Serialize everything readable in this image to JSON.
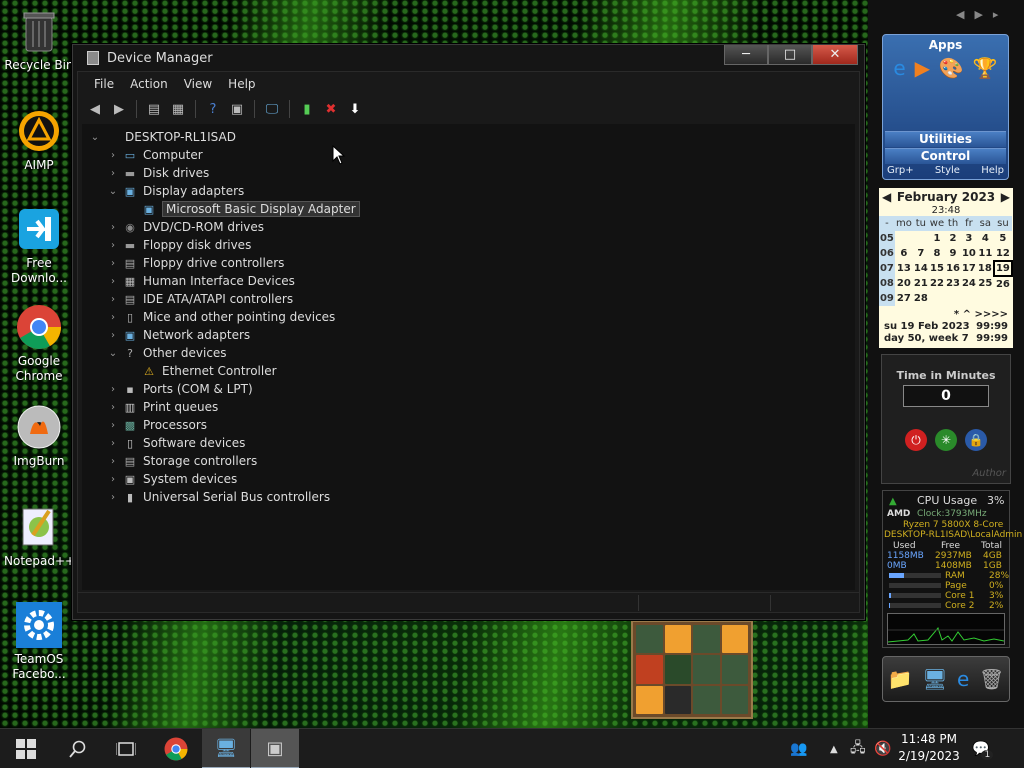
{
  "desktop": {
    "icons": [
      {
        "label": "Recycle Bin"
      },
      {
        "label": "AIMP"
      },
      {
        "label": "Free Downlo..."
      },
      {
        "label": "Google Chrome"
      },
      {
        "label": "ImgBurn"
      },
      {
        "label": "Notepad++"
      },
      {
        "label": "TeamOS Facebo..."
      }
    ]
  },
  "window": {
    "title": "Device Manager",
    "buttons": {
      "minimize": "─",
      "maximize": "□",
      "close": "✕"
    },
    "menu": [
      "File",
      "Action",
      "View",
      "Help"
    ],
    "tree": {
      "root": "DESKTOP-RL1ISAD",
      "items": [
        {
          "label": "Computer",
          "expanded": false
        },
        {
          "label": "Disk drives",
          "expanded": false
        },
        {
          "label": "Display adapters",
          "expanded": true,
          "children": [
            "Microsoft Basic Display Adapter"
          ]
        },
        {
          "label": "DVD/CD-ROM drives",
          "expanded": false
        },
        {
          "label": "Floppy disk drives",
          "expanded": false
        },
        {
          "label": "Floppy drive controllers",
          "expanded": false
        },
        {
          "label": "Human Interface Devices",
          "expanded": false
        },
        {
          "label": "IDE ATA/ATAPI controllers",
          "expanded": false
        },
        {
          "label": "Mice and other pointing devices",
          "expanded": false
        },
        {
          "label": "Network adapters",
          "expanded": false
        },
        {
          "label": "Other devices",
          "expanded": true,
          "children": [
            "Ethernet Controller"
          ]
        },
        {
          "label": "Ports (COM & LPT)",
          "expanded": false
        },
        {
          "label": "Print queues",
          "expanded": false
        },
        {
          "label": "Processors",
          "expanded": false
        },
        {
          "label": "Software devices",
          "expanded": false
        },
        {
          "label": "Storage controllers",
          "expanded": false
        },
        {
          "label": "System devices",
          "expanded": false
        },
        {
          "label": "Universal Serial Bus controllers",
          "expanded": false
        }
      ]
    }
  },
  "gadgets": {
    "apps": {
      "title": "Apps",
      "utilities": "Utilities",
      "control": "Control",
      "footer": [
        "Grp+",
        "Style",
        "Help"
      ]
    },
    "calendar": {
      "month": "February 2023",
      "time": "23:48",
      "days": [
        "-",
        "mo",
        "tu",
        "we",
        "th",
        "fr",
        "sa",
        "su"
      ],
      "weeks": [
        [
          "05",
          "",
          "",
          "1",
          "2",
          "3",
          "4",
          "5"
        ],
        [
          "06",
          "6",
          "7",
          "8",
          "9",
          "10",
          "11",
          "12"
        ],
        [
          "07",
          "13",
          "14",
          "15",
          "16",
          "17",
          "18",
          "19"
        ],
        [
          "08",
          "20",
          "21",
          "22",
          "23",
          "24",
          "25",
          "26"
        ],
        [
          "09",
          "27",
          "28",
          "",
          "",
          "",
          "",
          ""
        ]
      ],
      "nav": "*  ^ >>>>",
      "line1_left": "su 19 Feb 2023",
      "line1_right": "99:99",
      "line2_left": "day 50, week 7",
      "line2_right": "99:99"
    },
    "timer": {
      "title": "Time in Minutes",
      "value": "0",
      "author": "Author"
    },
    "cpu": {
      "title": "CPU Usage",
      "usage": "3%",
      "brand": "AMD",
      "clock": "Clock:3793MHz",
      "model": "Ryzen 7 5800X 8-Core",
      "user": "DESKTOP-RL1ISAD\\LocalAdmin",
      "headers": [
        "Used",
        "Free",
        "Total"
      ],
      "row1": [
        "1158MB",
        "2937MB",
        "4GB"
      ],
      "row2": [
        "0MB",
        "1408MB",
        "1GB"
      ],
      "stats": [
        {
          "label": "RAM",
          "value": "28%"
        },
        {
          "label": "Page",
          "value": "0%"
        },
        {
          "label": "Core 1",
          "value": "3%"
        },
        {
          "label": "Core 2",
          "value": "2%"
        }
      ]
    }
  },
  "taskbar": {
    "time": "11:48 PM",
    "date": "2/19/2023",
    "notifications": "1"
  },
  "colors": {
    "accent": "#3b9a2a",
    "calendar_bg": "#fffbe0",
    "apps_bg": "#2a5596"
  }
}
